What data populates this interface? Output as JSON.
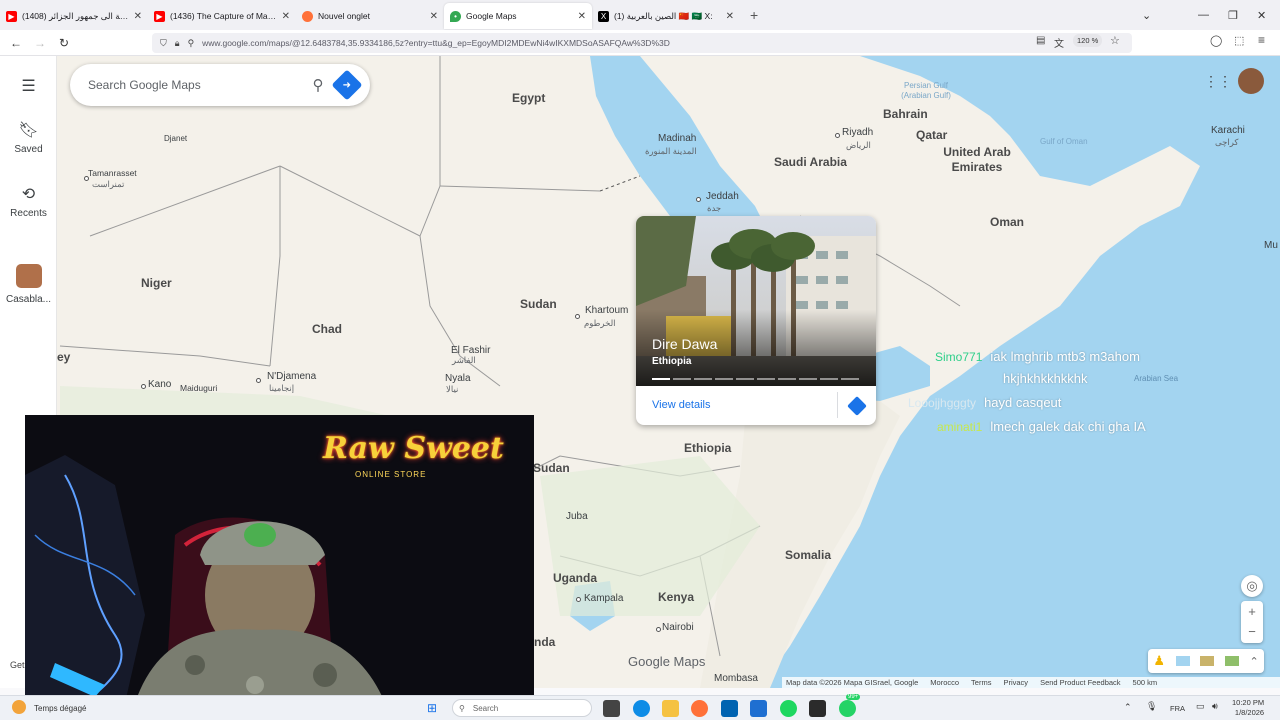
{
  "browser": {
    "tabs": [
      {
        "title": "رسالة الى جمهور الجزائر (1408)",
        "icon": "youtube-icon",
        "color": "#ff0000",
        "active": false
      },
      {
        "title": "(1436) The Capture of Maduro",
        "icon": "youtube-icon",
        "color": "#ff0000",
        "active": false
      },
      {
        "title": "Nouvel onglet",
        "icon": "firefox-icon",
        "color": "#ff7139",
        "active": false
      },
      {
        "title": "Google Maps",
        "icon": "google-maps-icon",
        "color": "#34a853",
        "active": true
      },
      {
        "title": "(1) الصين بالعربية 🇨🇳 🇸🇦 X: ",
        "icon": "x-icon",
        "color": "#000000",
        "active": false
      }
    ],
    "url": "www.google.com/maps/@12.6483784,35.9334186,5z?entry=ttu&g_ep=EgoyMDI2MDEwNi4wIKXMDSoASAFQAw%3D%3D",
    "zoom": "120 %"
  },
  "rail": {
    "saved": "Saved",
    "recents": "Recents",
    "casabla": "Casabla...",
    "get": "Get"
  },
  "search": {
    "placeholder": "Search Google Maps"
  },
  "map": {
    "countries": [
      "Egypt",
      "Saudi Arabia",
      "Bahrain",
      "Qatar",
      "United Arab Emirates",
      "Oman",
      "Niger",
      "Chad",
      "Sudan",
      "Ethiopia",
      "Somalia",
      "Uganda",
      "Kenya"
    ],
    "cities": {
      "madinah": "Madinah",
      "madinah_ar": "المدينة المنورة",
      "riyadh": "Riyadh",
      "riyadh_ar": "الرياض",
      "jeddah": "Jeddah",
      "jeddah_ar": "جدة",
      "karachi": "Karachi",
      "karachi_ar": "کراچی",
      "khartoum": "Khartoum",
      "khartoum_ar": "الخرطوم",
      "elfashir": "El Fashir",
      "elfashir_ar": "الفاشر",
      "nyala": "Nyala",
      "nyala_ar": "نيالا",
      "ndjamena": "N'Djamena",
      "ndjamena_ar": "إنجامينا",
      "kano": "Kano",
      "maiduguri": "Maiduguri",
      "tamanrasset": "Tamanrasset",
      "tamanrasset_ar": "تمنراست",
      "djanet": "Djanet",
      "juba": "Juba",
      "kampala": "Kampala",
      "nairobi": "Nairobi",
      "mombasa": "Mombasa"
    },
    "seas": {
      "persian_gulf": "Persian Gulf (Arabian Gulf)",
      "gulf_of_oman": "Gulf of Oman",
      "arabian_sea": "Arabian Sea"
    },
    "google_logo": "Google Maps",
    "partial_left": "ey",
    "partial_right": "Mu",
    "partial_sudan": "Sudan",
    "partial_anda": "nda"
  },
  "place_card": {
    "name": "Dire Dawa",
    "country": "Ethiopia",
    "view_details": "View details",
    "photo_count": 10,
    "photo_index": 1
  },
  "chat": [
    {
      "user": "Simo771",
      "message": "iak lmghrib mtb3 m3ahom"
    },
    {
      "user": "",
      "message": "hkjhkhkkhkkhk"
    },
    {
      "user": "Looojjhgggty",
      "message": "hayd casqeut"
    },
    {
      "user": "aminati1",
      "message": "lmech galek dak chi gha IA"
    }
  ],
  "overlay": {
    "neon_sign_line1": "Raw Sweet",
    "neon_sign_line2": "ONLINE STORE"
  },
  "attribution": {
    "mapdata": "Map data ©2026 Mapa GISrael, Google",
    "region": "Morocco",
    "terms": "Terms",
    "privacy": "Privacy",
    "feedback": "Send Product Feedback",
    "scale": "500 km"
  },
  "taskbar": {
    "weather": "Temps dégagé",
    "search": "Search",
    "lang": "FRA",
    "time": "10:20 PM",
    "date": "1/8/2026",
    "badge": "99+"
  },
  "colors": {
    "water": "#a3d4f0",
    "land": "#f4f1ea",
    "accent": "#1a73e8"
  }
}
